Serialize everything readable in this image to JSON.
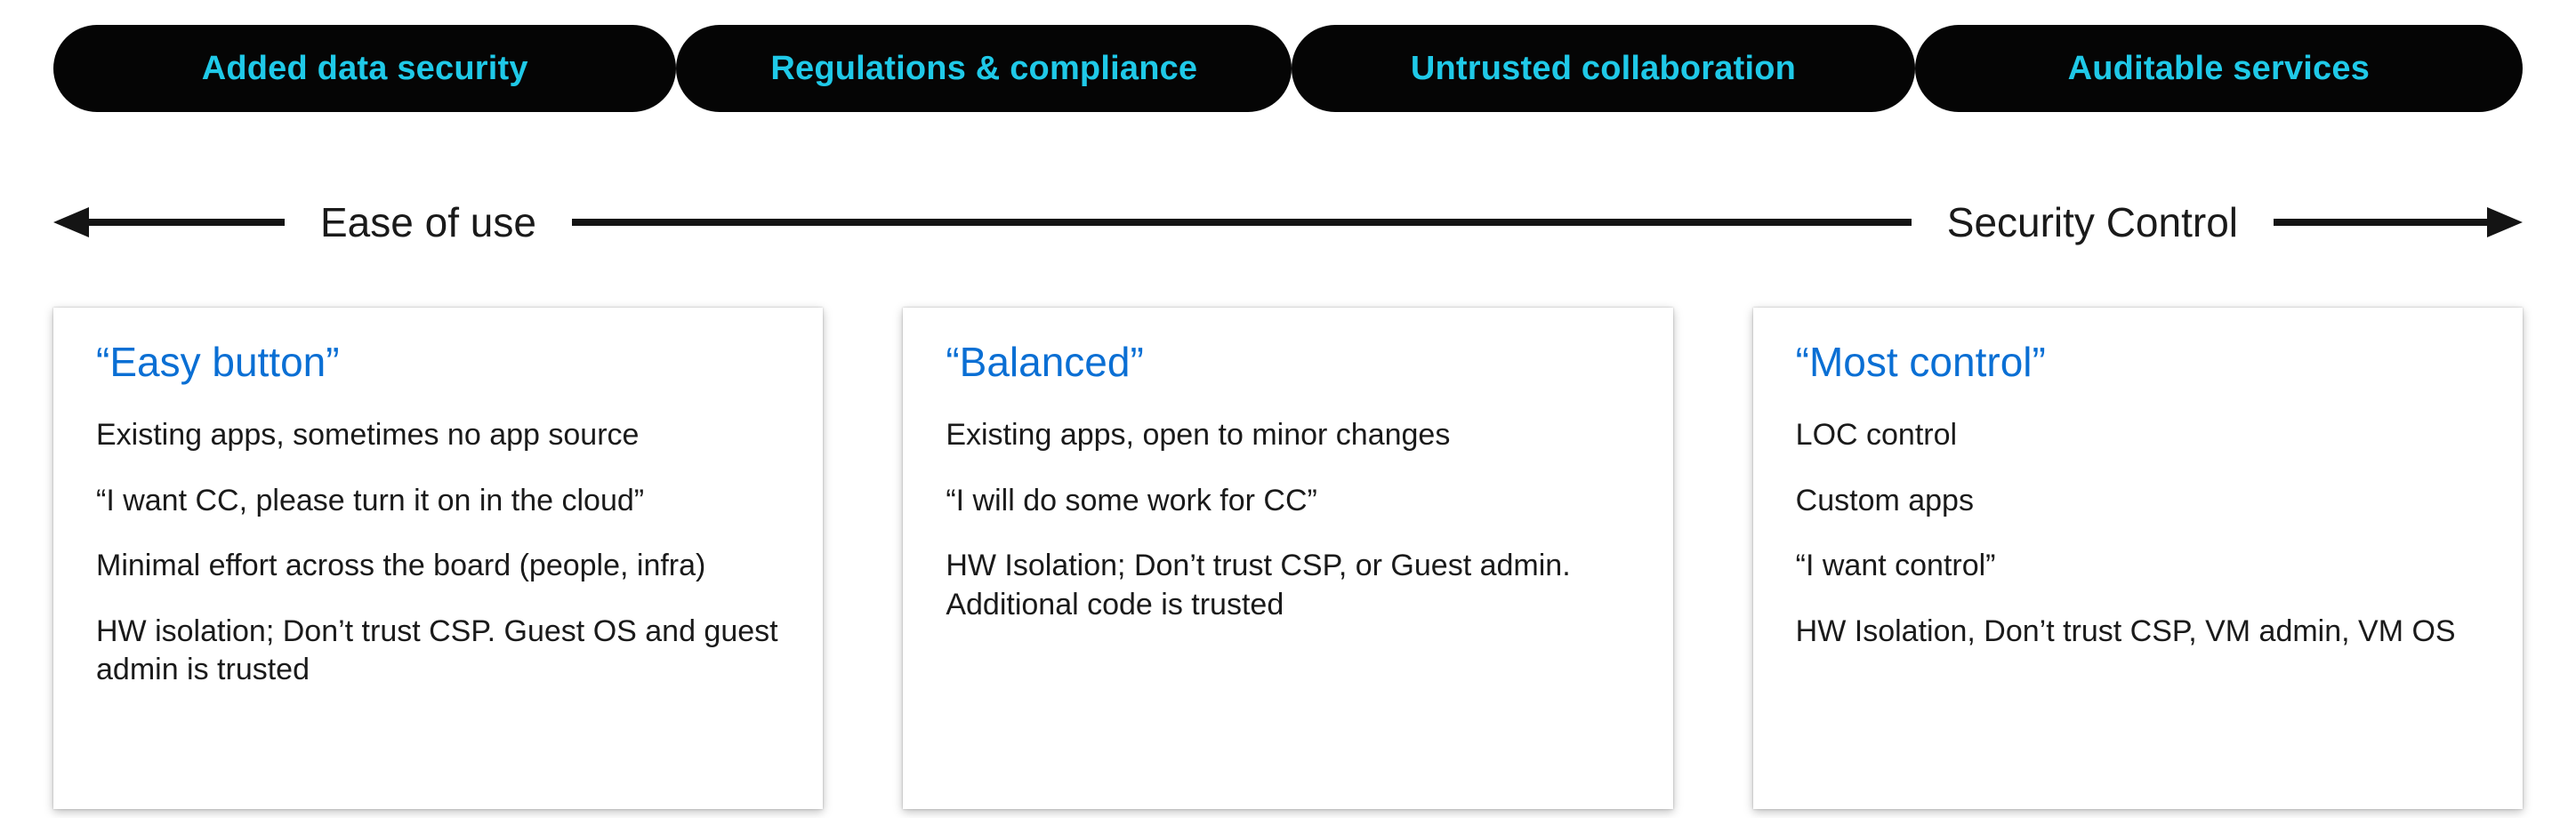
{
  "pills": [
    "Added data security",
    "Regulations & compliance",
    "Untrusted collaboration",
    "Auditable services"
  ],
  "axis": {
    "left_label": "Ease of use",
    "right_label": "Security Control"
  },
  "cards": [
    {
      "title": "“Easy button”",
      "lines": [
        "Existing apps, sometimes no app source",
        "“I want CC, please turn it on in the cloud”",
        "Minimal effort across the board (people, infra)",
        "HW isolation; Don’t trust CSP. Guest OS and guest admin is trusted"
      ]
    },
    {
      "title": "“Balanced”",
      "lines": [
        "Existing apps, open to minor changes",
        "“I will do some work for CC”",
        "HW Isolation; Don’t trust CSP, or Guest admin. Additional code is trusted"
      ]
    },
    {
      "title": "“Most control”",
      "lines": [
        "LOC control",
        "Custom apps",
        "“I want control”",
        "HW Isolation, Don’t trust CSP, VM admin, VM OS"
      ]
    }
  ]
}
